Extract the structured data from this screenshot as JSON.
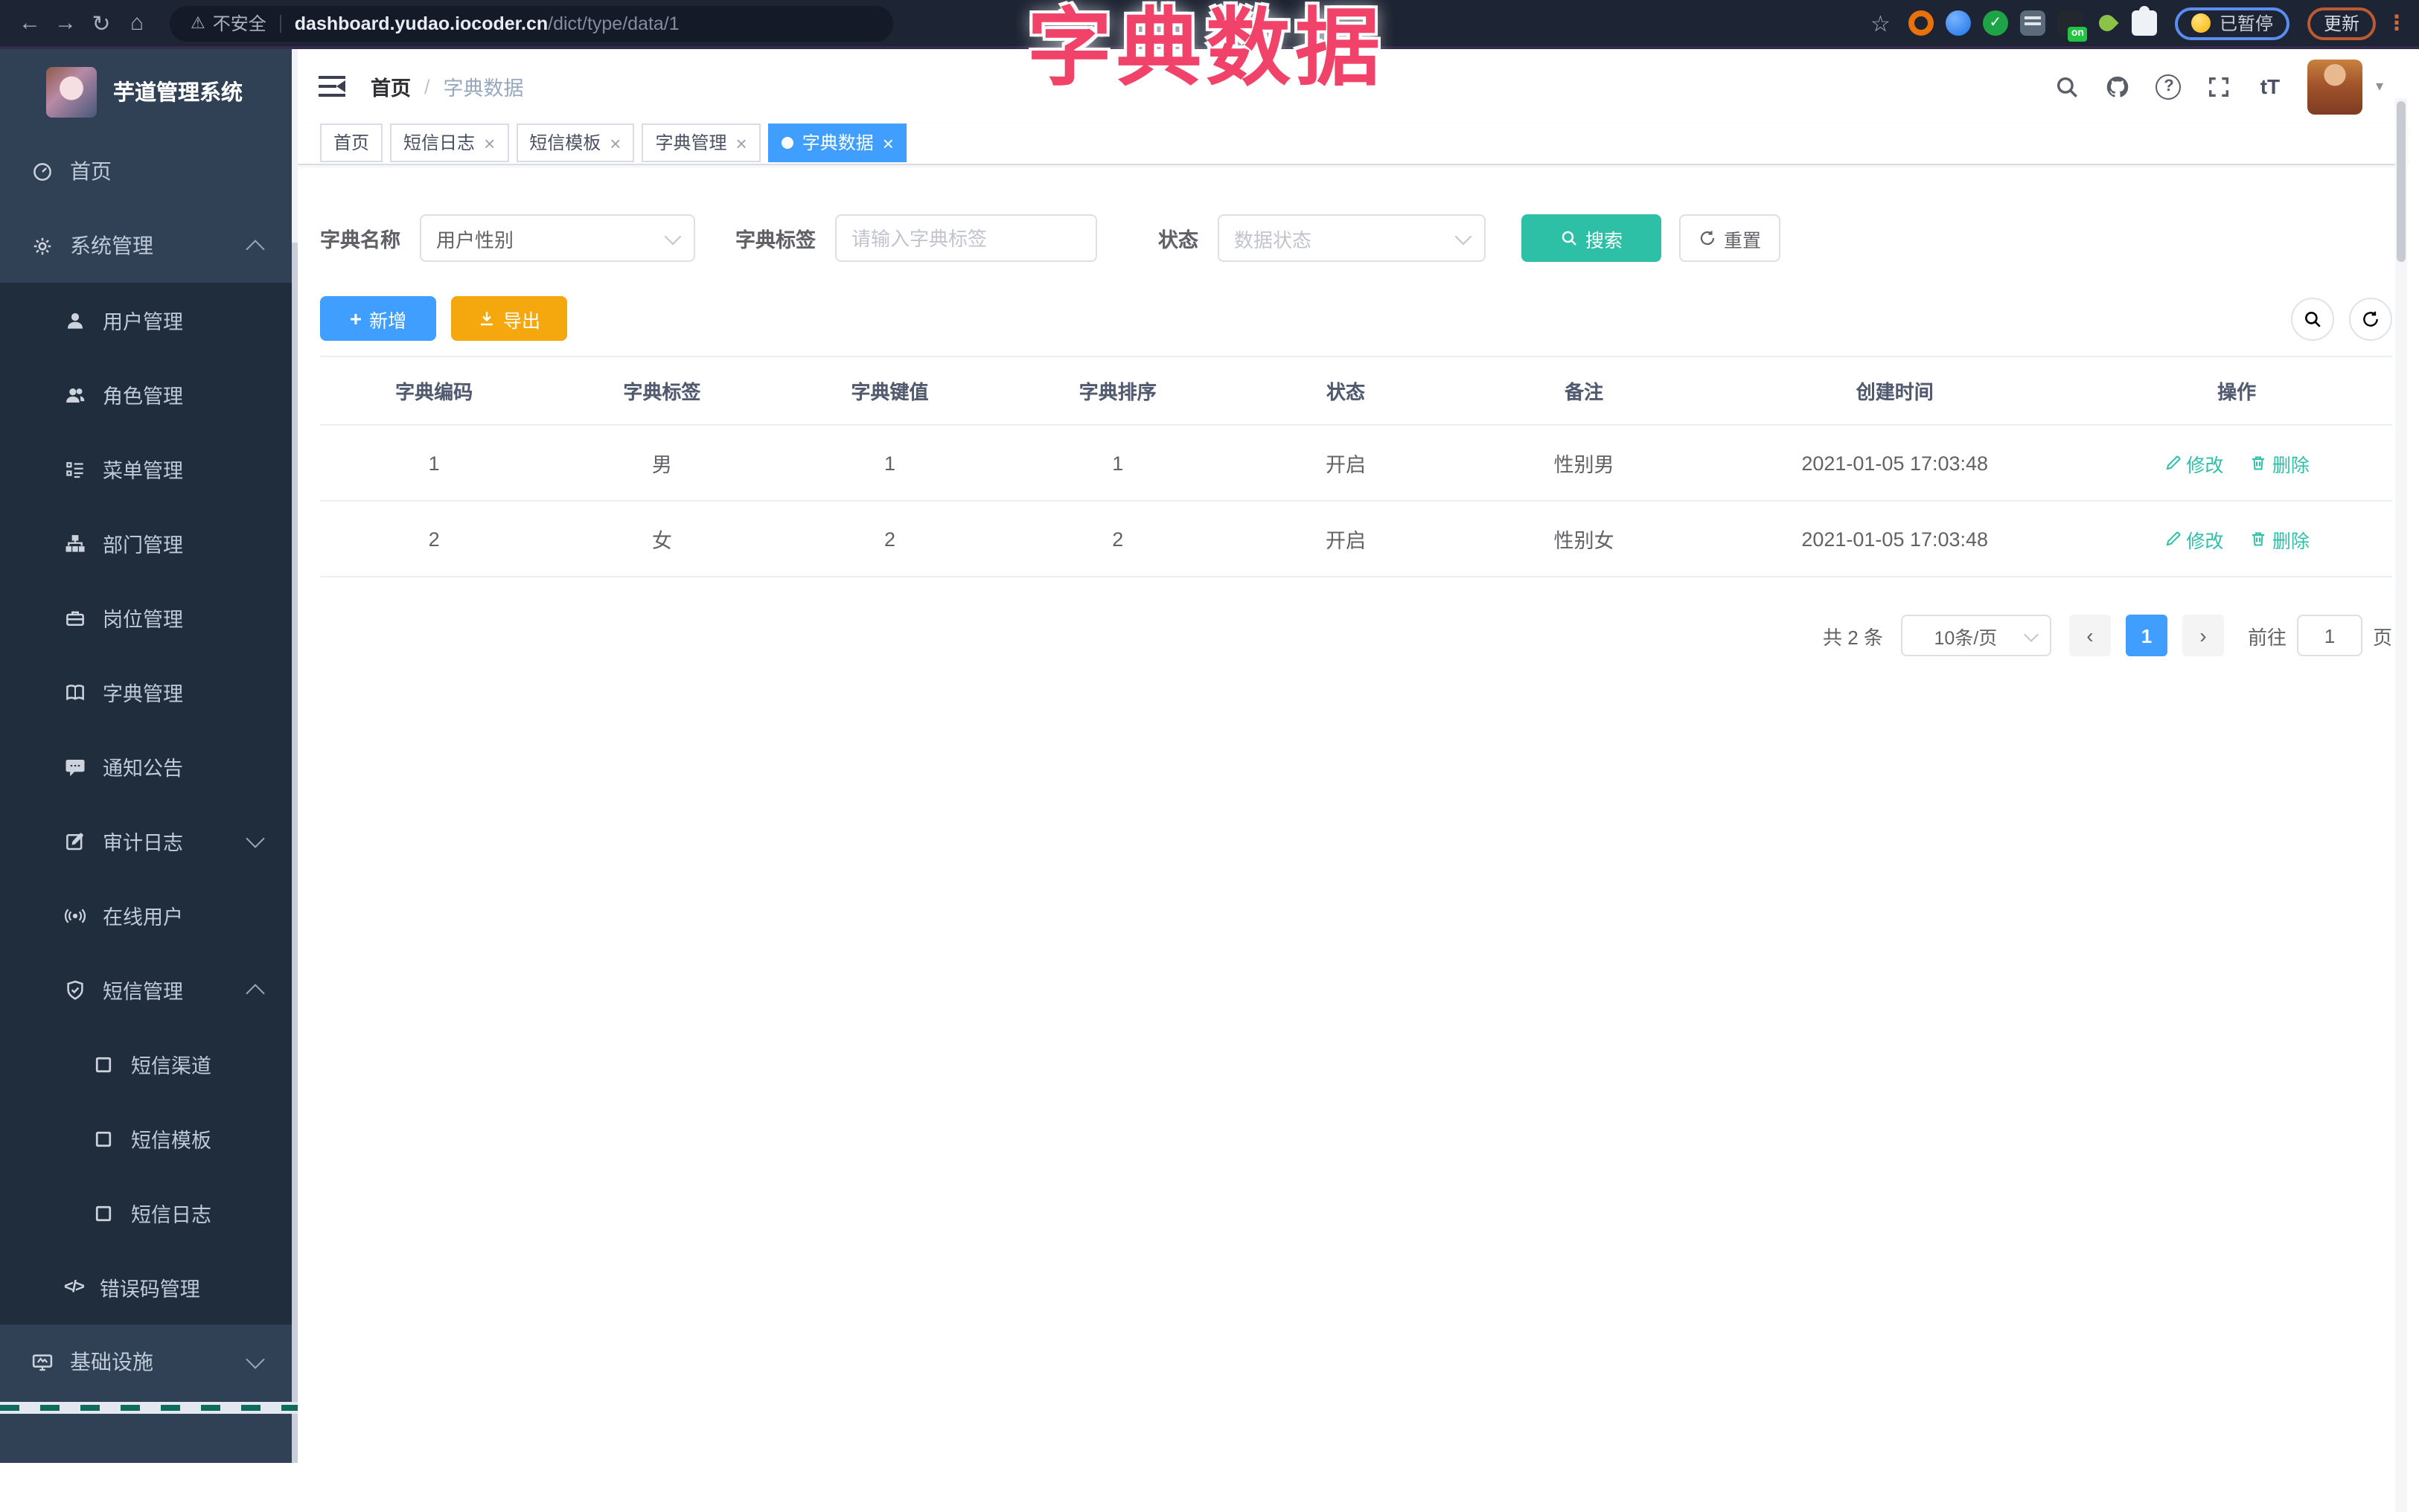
{
  "browser": {
    "security_label": "不安全",
    "url_host": "dashboard.yudao.iocoder.cn",
    "url_path": "/dict/type/data/1",
    "paused_label": "已暂停",
    "update_label": "更新",
    "on_badge": "on"
  },
  "overlay_title": "字典数据",
  "icons": {
    "back": "←",
    "forward": "→",
    "reload": "↻",
    "home": "⌂",
    "star": "☆",
    "warning": "⚠",
    "kebab": "⋮",
    "close": "×",
    "question": "?",
    "font_size": "tT",
    "caret_down": "▾",
    "plus": "+",
    "code": "</>",
    "check": "✓",
    "prev": "‹",
    "next": "›"
  },
  "sidebar": {
    "logo_title": "芋道管理系统",
    "items": [
      {
        "label": "首页",
        "icon": "dashboard-icon",
        "level": 1
      },
      {
        "label": "系统管理",
        "icon": "gear-icon",
        "level": 1,
        "chevron": "up"
      },
      {
        "label": "用户管理",
        "icon": "user-icon",
        "level": 2
      },
      {
        "label": "角色管理",
        "icon": "users-icon",
        "level": 2
      },
      {
        "label": "菜单管理",
        "icon": "list-icon",
        "level": 2
      },
      {
        "label": "部门管理",
        "icon": "org-tree-icon",
        "level": 2
      },
      {
        "label": "岗位管理",
        "icon": "briefcase-icon",
        "level": 2
      },
      {
        "label": "字典管理",
        "icon": "book-icon",
        "level": 2
      },
      {
        "label": "通知公告",
        "icon": "megaphone-icon",
        "level": 2
      },
      {
        "label": "审计日志",
        "icon": "edit-square-icon",
        "level": 2,
        "chevron": "down"
      },
      {
        "label": "在线用户",
        "icon": "online-icon",
        "level": 2
      },
      {
        "label": "短信管理",
        "icon": "shield-check-icon",
        "level": 2,
        "chevron": "up"
      },
      {
        "label": "短信渠道",
        "icon": "square-icon",
        "level": 3
      },
      {
        "label": "短信模板",
        "icon": "square-icon",
        "level": 3
      },
      {
        "label": "短信日志",
        "icon": "square-icon",
        "level": 3
      },
      {
        "label": "错误码管理",
        "icon": "code-icon",
        "level": 2
      },
      {
        "label": "基础设施",
        "icon": "monitor-icon",
        "level": 1,
        "chevron": "down"
      }
    ]
  },
  "header": {
    "breadcrumb": [
      "首页",
      "字典数据"
    ]
  },
  "tabs": [
    {
      "label": "首页",
      "closable": false,
      "active": false
    },
    {
      "label": "短信日志",
      "closable": true,
      "active": false
    },
    {
      "label": "短信模板",
      "closable": true,
      "active": false
    },
    {
      "label": "字典管理",
      "closable": true,
      "active": false
    },
    {
      "label": "字典数据",
      "closable": true,
      "active": true
    }
  ],
  "filter": {
    "name_label": "字典名称",
    "name_value": "用户性别",
    "tag_label": "字典标签",
    "tag_placeholder": "请输入字典标签",
    "status_label": "状态",
    "status_placeholder": "数据状态",
    "search_label": "搜索",
    "reset_label": "重置"
  },
  "toolbar": {
    "add_label": "新增",
    "export_label": "导出"
  },
  "table": {
    "columns": [
      "字典编码",
      "字典标签",
      "字典键值",
      "字典排序",
      "状态",
      "备注",
      "创建时间",
      "操作"
    ],
    "rows": [
      [
        "1",
        "男",
        "1",
        "1",
        "开启",
        "性别男",
        "2021-01-05 17:03:48"
      ],
      [
        "2",
        "女",
        "2",
        "2",
        "开启",
        "性别女",
        "2021-01-05 17:03:48"
      ]
    ],
    "actions": {
      "edit": "修改",
      "delete": "删除"
    }
  },
  "pagination": {
    "total": "共 2 条",
    "page_size": "10条/页",
    "current": "1",
    "goto_label": "前往",
    "goto_value": "1",
    "unit_label": "页"
  },
  "colors": {
    "primary": "#409eff",
    "teal": "#2ec0a6",
    "export_orange": "#f5a70e",
    "overlay_red": "#f1426a",
    "sidebar_bg": "#304156",
    "submenu_bg": "#1f2d3d",
    "browser_bar": "#1d2433"
  }
}
